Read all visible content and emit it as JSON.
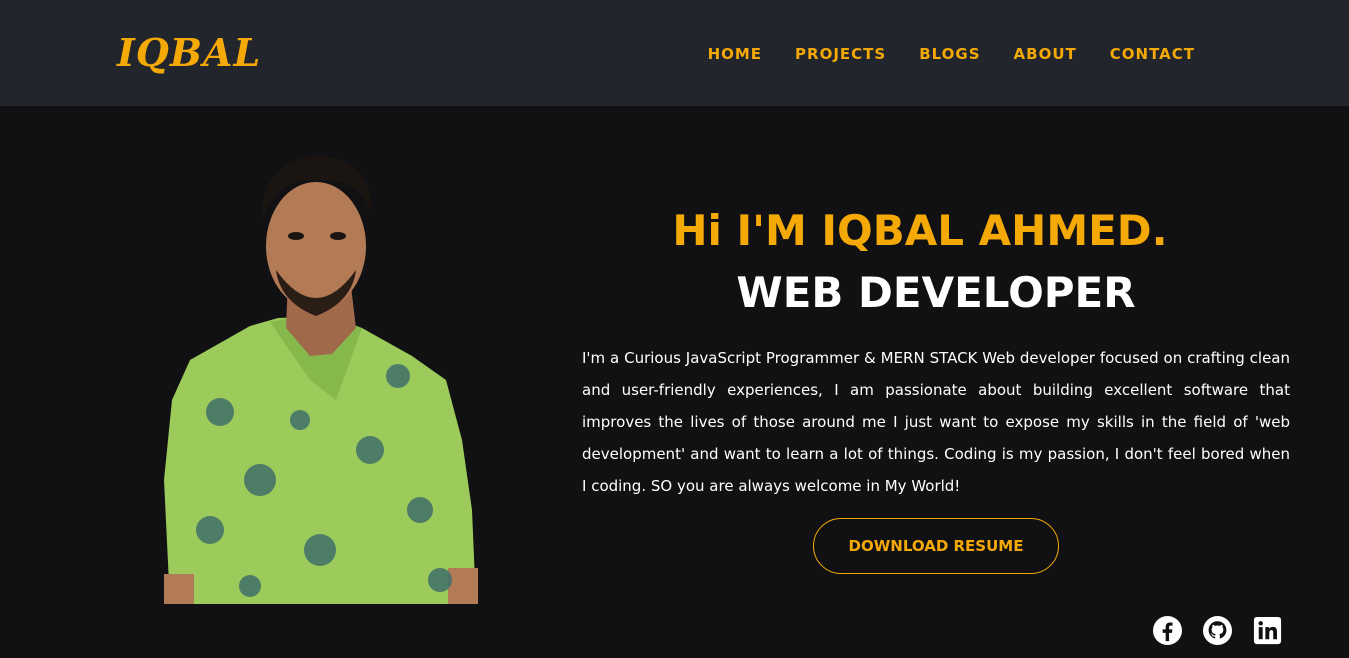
{
  "header": {
    "logo": "IQBAL",
    "nav": [
      "HOME",
      "PROJECTS",
      "BLOGS",
      "ABOUT",
      "CONTACT"
    ]
  },
  "hero": {
    "greeting": "Hi I'M IQBAL AHMED.",
    "role": "WEB DEVELOPER",
    "bio": "I'm a Curious JavaScript Programmer & MERN STACK Web developer focused on crafting clean and user-friendly experiences, I am passionate about building excellent software that improves the lives of those around me I just want to expose my skills in the field of 'web development' and want to learn a lot of things. Coding is my passion, I don't feel bored when I coding. SO you are always welcome in My World!",
    "resume_button": "DOWNLOAD RESUME"
  },
  "socials": [
    "facebook-icon",
    "github-icon",
    "linkedin-icon"
  ],
  "colors": {
    "accent": "#f5a906",
    "header_bg": "#22252c",
    "page_bg": "#111113",
    "text": "#ffffff"
  }
}
